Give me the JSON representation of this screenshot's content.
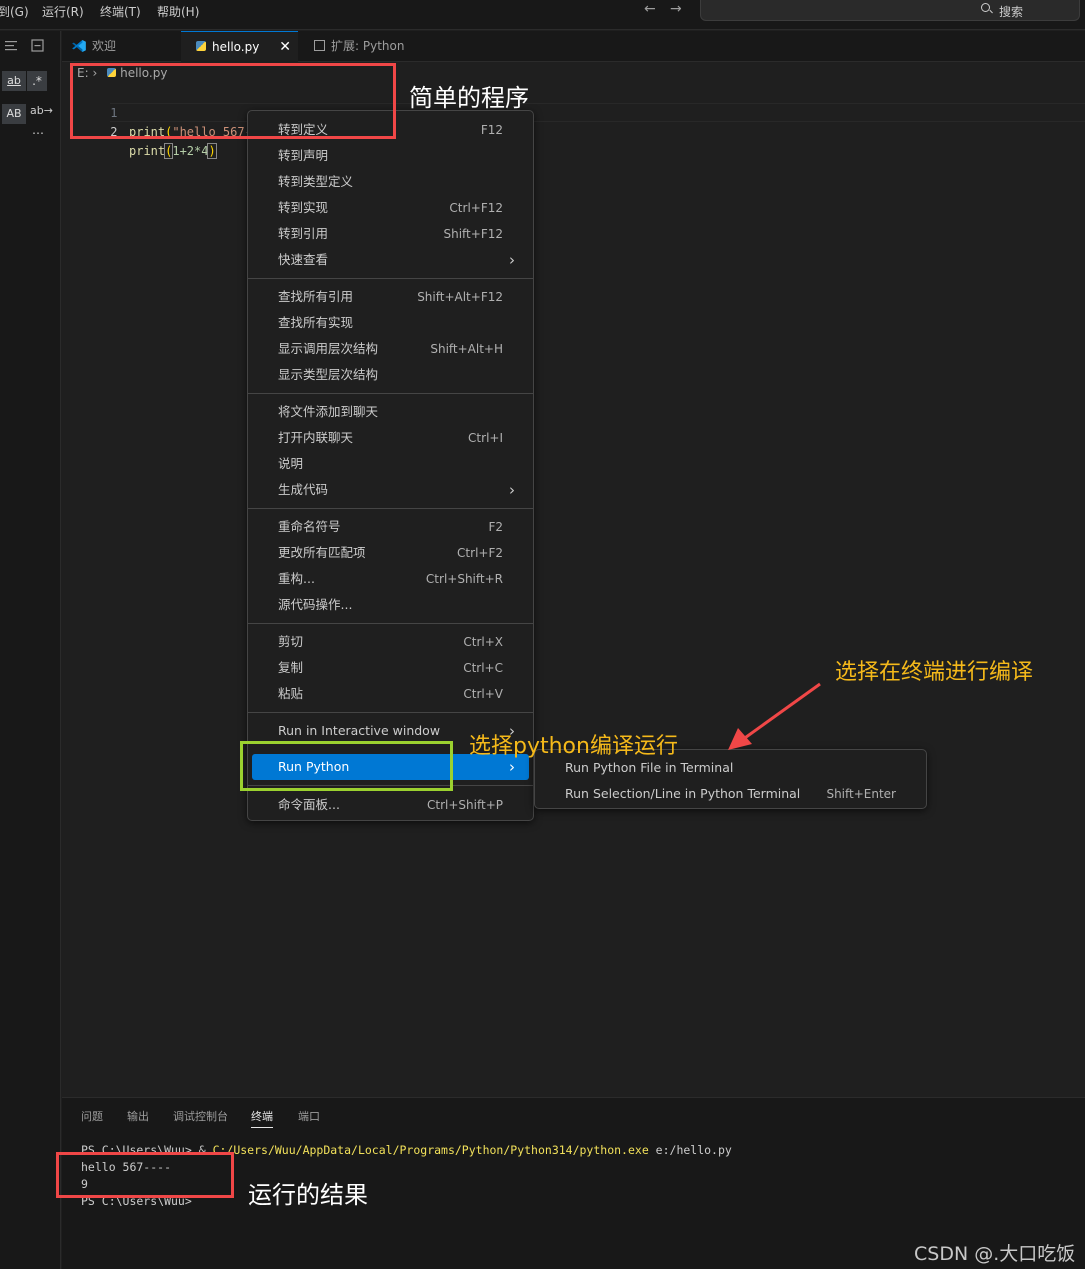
{
  "menubar": {
    "items": [
      "到(G)",
      "运行(R)",
      "终端(T)",
      "帮助(H)"
    ],
    "back": "←",
    "forward": "→",
    "search_label": "搜索"
  },
  "sidebar": {
    "ab_label": "ab",
    "regex_label": ".*",
    "AB_label": "AB",
    "replace_label": "ab→",
    "more_label": "…"
  },
  "tabs": [
    {
      "label": "欢迎"
    },
    {
      "label": "hello.py",
      "close": "✕"
    },
    {
      "label": "扩展: Python"
    }
  ],
  "breadcrumb": {
    "drive": "E:",
    "file": "hello.py"
  },
  "editor": {
    "lines": [
      {
        "num": "1",
        "fn": "print",
        "open": "(",
        "arg": "\"hello 567----\"",
        "close": ")"
      },
      {
        "num": "2",
        "fn": "print",
        "open": "(",
        "arg": "1+2*4",
        "close": ")"
      }
    ]
  },
  "context_menu": {
    "groups": [
      [
        {
          "label": "转到定义",
          "key": "F12"
        },
        {
          "label": "转到声明",
          "key": ""
        },
        {
          "label": "转到类型定义",
          "key": ""
        },
        {
          "label": "转到实现",
          "key": "Ctrl+F12"
        },
        {
          "label": "转到引用",
          "key": "Shift+F12"
        },
        {
          "label": "快速查看",
          "key": "",
          "submenu": true
        }
      ],
      [
        {
          "label": "查找所有引用",
          "key": "Shift+Alt+F12"
        },
        {
          "label": "查找所有实现",
          "key": ""
        },
        {
          "label": "显示调用层次结构",
          "key": "Shift+Alt+H"
        },
        {
          "label": "显示类型层次结构",
          "key": ""
        }
      ],
      [
        {
          "label": "将文件添加到聊天",
          "key": ""
        },
        {
          "label": "打开内联聊天",
          "key": "Ctrl+I"
        },
        {
          "label": "说明",
          "key": ""
        },
        {
          "label": "生成代码",
          "key": "",
          "submenu": true
        }
      ],
      [
        {
          "label": "重命名符号",
          "key": "F2"
        },
        {
          "label": "更改所有匹配项",
          "key": "Ctrl+F2"
        },
        {
          "label": "重构...",
          "key": "Ctrl+Shift+R"
        },
        {
          "label": "源代码操作...",
          "key": ""
        }
      ],
      [
        {
          "label": "剪切",
          "key": "Ctrl+X"
        },
        {
          "label": "复制",
          "key": "Ctrl+C"
        },
        {
          "label": "粘贴",
          "key": "Ctrl+V"
        }
      ],
      [
        {
          "label": "Run in Interactive window",
          "key": "",
          "submenu": true
        },
        {
          "label": "Run Python",
          "key": "",
          "submenu": true,
          "highlighted": true
        }
      ],
      [
        {
          "label": "命令面板...",
          "key": "Ctrl+Shift+P"
        }
      ]
    ],
    "arrow": "›"
  },
  "submenu": {
    "items": [
      {
        "label": "Run Python File in Terminal",
        "key": ""
      },
      {
        "label": "Run Selection/Line in Python Terminal",
        "key": "Shift+Enter"
      }
    ]
  },
  "panel": {
    "tabs": [
      "问题",
      "输出",
      "调试控制台",
      "终端",
      "端口"
    ],
    "active_tab": "终端",
    "terminal": {
      "cmd_prefix": "PS C:\\Users\\Wuu> & ",
      "cmd_path": "C:/Users/Wuu/AppData/Local/Programs/Python/Python314/python.exe",
      "cmd_arg": " e:/hello.py",
      "output_1": "hello 567----",
      "output_2": "9",
      "prompt": "PS C:\\Users\\Wuu>"
    }
  },
  "annotations": {
    "simple_program": "简单的程序",
    "choose_terminal": "选择在终端进行编译",
    "choose_python": "选择python编译运行",
    "run_result": "运行的结果",
    "box_red": "#f04747",
    "box_green": "#9bd12f",
    "text_yellow": "#f5b91a"
  },
  "watermark": "CSDN @.大口吃饭",
  "colors": {
    "accent": "#0078d4",
    "editor_bg": "#1f1f1f",
    "chrome_bg": "#181818"
  }
}
